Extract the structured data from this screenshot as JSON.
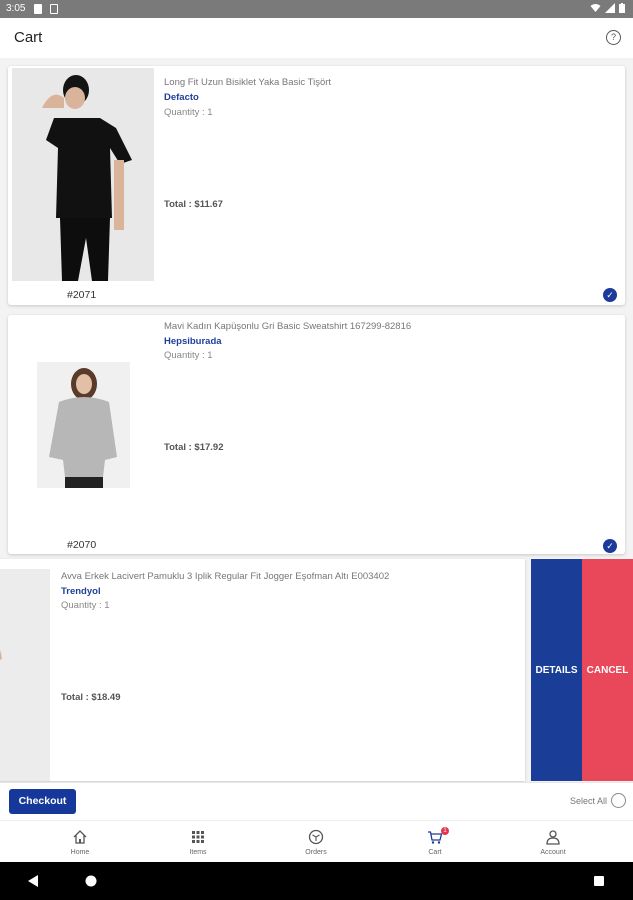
{
  "status": {
    "time": "3:05"
  },
  "appbar": {
    "title": "Cart",
    "help_icon": "help-circle-icon"
  },
  "items": [
    {
      "name": "Long Fit Uzun Bisiklet Yaka Basic Tişört",
      "brand": "Defacto",
      "quantity": "Quantity : 1",
      "total": "Total : $11.67",
      "order_no": "#2071",
      "selected": true
    },
    {
      "name": "Mavi Kadın Kapüşonlu Gri Basic Sweatshirt 167299-82816",
      "brand": "Hepsiburada",
      "quantity": "Quantity : 1",
      "total": "Total : $17.92",
      "order_no": "#2070",
      "selected": true
    },
    {
      "name": "Avva Erkek Lacivert Pamuklu 3 Iplik Regular Fit Jogger Eşofman Altı E003402",
      "brand": "Trendyol",
      "quantity": "Quantity : 1",
      "total": "Total : $18.49"
    }
  ],
  "swipe_actions": {
    "details": "DETAILS",
    "cancel": "CANCEL"
  },
  "checkout": {
    "button": "Checkout",
    "select_all": "Select All"
  },
  "bottom_nav": [
    {
      "label": "Home",
      "icon": "home-icon"
    },
    {
      "label": "Items",
      "icon": "grid-icon"
    },
    {
      "label": "Orders",
      "icon": "box-icon"
    },
    {
      "label": "Cart",
      "icon": "cart-icon",
      "badge": "1",
      "active": true
    },
    {
      "label": "Account",
      "icon": "person-icon"
    }
  ],
  "colors": {
    "primary": "#16389a",
    "brand_text": "#1f3f9b",
    "cancel": "#e8485a",
    "details": "#1a3d97",
    "badge": "#e8344d"
  }
}
